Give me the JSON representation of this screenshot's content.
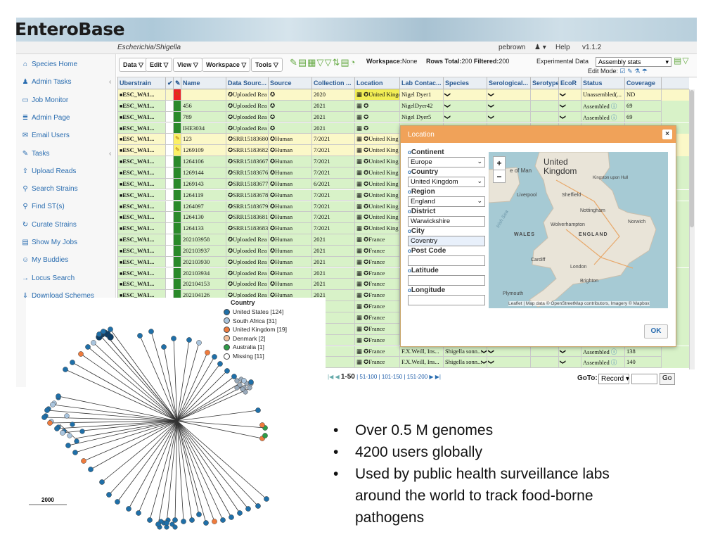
{
  "app": {
    "logo": "EnteroBase",
    "organism": "Escherichia/Shigella",
    "user": "pebrown",
    "help": "Help",
    "version": "v1.1.2"
  },
  "sidebar": [
    {
      "label": "Species Home",
      "icon": "home-icon",
      "glyph": "⌂"
    },
    {
      "label": "Admin Tasks",
      "icon": "person-icon",
      "glyph": "♟",
      "chevron": "‹"
    },
    {
      "label": "Job Monitor",
      "icon": "monitor-icon",
      "glyph": "▭"
    },
    {
      "label": "Admin Page",
      "icon": "page-icon",
      "glyph": "≣"
    },
    {
      "label": "Email Users",
      "icon": "envelope-icon",
      "glyph": "✉"
    },
    {
      "label": "Tasks",
      "icon": "wrench-icon",
      "glyph": "✎",
      "chevron": "‹"
    },
    {
      "label": "Upload Reads",
      "icon": "upload-icon",
      "glyph": "⇪"
    },
    {
      "label": "Search Strains",
      "icon": "search-strains-icon",
      "glyph": "⚲"
    },
    {
      "label": "Find ST(s)",
      "icon": "magnifier-icon",
      "glyph": "⚲"
    },
    {
      "label": "Curate Strains",
      "icon": "refresh-icon",
      "glyph": "↻"
    },
    {
      "label": "Show My Jobs",
      "icon": "list-icon",
      "glyph": "▤"
    },
    {
      "label": "My Buddies",
      "icon": "people-icon",
      "glyph": "☺"
    },
    {
      "label": "Locus Search",
      "icon": "arrow-icon",
      "glyph": "→"
    },
    {
      "label": "Download Schemes",
      "icon": "download-icon",
      "glyph": "⇓"
    }
  ],
  "toolbar": {
    "menus": [
      "Data",
      "Edit",
      "View",
      "Workspace",
      "Tools"
    ],
    "workspace_label": "Workspace:",
    "workspace_value": "None",
    "rows_total_label": "Rows Total:",
    "rows_total": "200",
    "filtered_label": "Filtered:",
    "filtered": "200",
    "experimental_label": "Experimental Data",
    "experimental_value": "Assembly stats",
    "edit_mode_label": "Edit Mode:"
  },
  "columns": [
    "Uberstrain",
    "✔",
    "✎",
    "Name",
    "Data Sourc...",
    "Source",
    "Collection ...",
    "Location",
    "Lab Contac...",
    "Species",
    "Serological...",
    "Serotype",
    "EcoR",
    "Status",
    "Coverage"
  ],
  "rows": [
    {
      "uber": "ESC_WA1...",
      "mark": "red",
      "name": "",
      "ds": "Uploaded Rea",
      "src": "",
      "date": "2020",
      "loc": "United Kingdo",
      "lab": "Nigel Dyer1",
      "sp": "",
      "status": "Unassembled(...",
      "cov": "ND",
      "bg": "yellow"
    },
    {
      "uber": "ESC_WA1...",
      "mark": "green",
      "name": "456",
      "ds": "Uploaded Rea",
      "src": "",
      "date": "2021",
      "loc": "",
      "lab": "NigelDyer42",
      "sp": "",
      "status": "Assembled",
      "cov": "69",
      "bg": "green"
    },
    {
      "uber": "ESC_WA1...",
      "mark": "green",
      "name": "789",
      "ds": "Uploaded Rea",
      "src": "",
      "date": "2021",
      "loc": "",
      "lab": "Nigel Dyer5",
      "sp": "",
      "status": "Assembled",
      "cov": "69",
      "bg": "green"
    },
    {
      "uber": "ESC_WA1...",
      "mark": "green",
      "name": "IHE3034",
      "ds": "Uploaded Rea",
      "src": "",
      "date": "2021",
      "loc": "",
      "lab": "",
      "sp": "",
      "status": "",
      "cov": "",
      "bg": "green"
    },
    {
      "uber": "ESC_WA1...",
      "mark": "yellow",
      "name": "123",
      "ds": "SRR15183680",
      "src": "Human",
      "date": "7/2021",
      "loc": "United King",
      "lab": "",
      "sp": "",
      "status": "",
      "cov": "",
      "bg": "yellow"
    },
    {
      "uber": "ESC_WA1...",
      "mark": "yellow",
      "name": "1269109",
      "ds": "SRR15183682",
      "src": "Human",
      "date": "7/2021",
      "loc": "United King",
      "lab": "",
      "sp": "",
      "status": "",
      "cov": "",
      "bg": "yellow"
    },
    {
      "uber": "ESC_WA1...",
      "mark": "green",
      "name": "1264106",
      "ds": "SRR15183667",
      "src": "Human",
      "date": "7/2021",
      "loc": "United King",
      "lab": "",
      "sp": "",
      "status": "",
      "cov": "",
      "bg": "green"
    },
    {
      "uber": "ESC_WA1...",
      "mark": "green",
      "name": "1269144",
      "ds": "SRR15183676",
      "src": "Human",
      "date": "7/2021",
      "loc": "United King",
      "lab": "",
      "sp": "",
      "status": "",
      "cov": "",
      "bg": "green"
    },
    {
      "uber": "ESC_WA1...",
      "mark": "green",
      "name": "1269143",
      "ds": "SRR15183677",
      "src": "Human",
      "date": "6/2021",
      "loc": "United King",
      "lab": "",
      "sp": "",
      "status": "",
      "cov": "",
      "bg": "green"
    },
    {
      "uber": "ESC_WA1...",
      "mark": "green",
      "name": "1264119",
      "ds": "SRR15183678",
      "src": "Human",
      "date": "7/2021",
      "loc": "United King",
      "lab": "",
      "sp": "",
      "status": "",
      "cov": "",
      "bg": "green"
    },
    {
      "uber": "ESC_WA1...",
      "mark": "green",
      "name": "1264097",
      "ds": "SRR15183679",
      "src": "Human",
      "date": "7/2021",
      "loc": "United King",
      "lab": "",
      "sp": "",
      "status": "",
      "cov": "",
      "bg": "green"
    },
    {
      "uber": "ESC_WA1...",
      "mark": "green",
      "name": "1264130",
      "ds": "SRR15183681",
      "src": "Human",
      "date": "7/2021",
      "loc": "United King",
      "lab": "",
      "sp": "",
      "status": "",
      "cov": "",
      "bg": "green"
    },
    {
      "uber": "ESC_WA1...",
      "mark": "green",
      "name": "1264133",
      "ds": "SRR15183683",
      "src": "Human",
      "date": "7/2021",
      "loc": "United King",
      "lab": "",
      "sp": "",
      "status": "",
      "cov": "",
      "bg": "green"
    },
    {
      "uber": "ESC_WA1...",
      "mark": "green",
      "name": "202103958",
      "ds": "Uploaded Rea",
      "src": "Human",
      "date": "2021",
      "loc": "France",
      "lab": "",
      "sp": "",
      "status": "",
      "cov": "",
      "bg": "green"
    },
    {
      "uber": "ESC_WA1...",
      "mark": "green",
      "name": "202103937",
      "ds": "Uploaded Rea",
      "src": "Human",
      "date": "2021",
      "loc": "France",
      "lab": "",
      "sp": "",
      "status": "",
      "cov": "",
      "bg": "green"
    },
    {
      "uber": "ESC_WA1...",
      "mark": "green",
      "name": "202103930",
      "ds": "Uploaded Rea",
      "src": "Human",
      "date": "2021",
      "loc": "France",
      "lab": "",
      "sp": "",
      "status": "",
      "cov": "",
      "bg": "green"
    },
    {
      "uber": "ESC_WA1...",
      "mark": "green",
      "name": "202103934",
      "ds": "Uploaded Rea",
      "src": "Human",
      "date": "2021",
      "loc": "France",
      "lab": "",
      "sp": "",
      "status": "",
      "cov": "",
      "bg": "green"
    },
    {
      "uber": "ESC_WA1...",
      "mark": "green",
      "name": "202104153",
      "ds": "Uploaded Rea",
      "src": "Human",
      "date": "2021",
      "loc": "France",
      "lab": "",
      "sp": "",
      "status": "",
      "cov": "",
      "bg": "green"
    },
    {
      "uber": "ESC_WA1...",
      "mark": "green",
      "name": "202104126",
      "ds": "Uploaded Rea",
      "src": "Human",
      "date": "2021",
      "loc": "France",
      "lab": "",
      "sp": "",
      "status": "",
      "cov": "",
      "bg": "green"
    },
    {
      "uber": "",
      "mark": "",
      "name": "",
      "ds": "",
      "src": "",
      "date": "21",
      "loc": "France",
      "lab": "",
      "sp": "",
      "status": "",
      "cov": "",
      "bg": "green"
    },
    {
      "uber": "",
      "mark": "",
      "name": "",
      "ds": "",
      "src": "",
      "date": "21",
      "loc": "France",
      "lab": "",
      "sp": "",
      "status": "",
      "cov": "",
      "bg": "green"
    },
    {
      "uber": "",
      "mark": "",
      "name": "",
      "ds": "",
      "src": "",
      "date": "21",
      "loc": "France",
      "lab": "",
      "sp": "",
      "status": "",
      "cov": "",
      "bg": "green"
    },
    {
      "uber": "",
      "mark": "",
      "name": "",
      "ds": "",
      "src": "",
      "date": "21",
      "loc": "France",
      "lab": "",
      "sp": "",
      "status": "",
      "cov": "",
      "bg": "green"
    },
    {
      "uber": "",
      "mark": "",
      "name": "",
      "ds": "",
      "src": "",
      "date": "21",
      "loc": "France",
      "lab": "F.X.Weill, Ins...",
      "sp": "Shigella sonn...",
      "status": "Assembled",
      "cov": "138",
      "bg": "green"
    },
    {
      "uber": "",
      "mark": "",
      "name": "",
      "ds": "",
      "src": "",
      "date": "21",
      "loc": "France",
      "lab": "F.X.Weill, Ins...",
      "sp": "Shigella sonn...",
      "status": "Assembled",
      "cov": "140",
      "bg": "green"
    }
  ],
  "pager": {
    "current": "1-50",
    "pages": [
      "51-100",
      "101-150",
      "151-200"
    ],
    "goto_label": "GoTo:",
    "goto_select": "Record",
    "go_button": "Go"
  },
  "location_dialog": {
    "title": "Location",
    "close": "×",
    "fields": [
      {
        "label": "Continent",
        "value": "Europe",
        "type": "select"
      },
      {
        "label": "Country",
        "value": "United Kingdom",
        "type": "select"
      },
      {
        "label": "Region",
        "value": "England",
        "type": "select"
      },
      {
        "label": "District",
        "value": "Warwickshire",
        "type": "text"
      },
      {
        "label": "City",
        "value": "Coventry",
        "type": "text"
      },
      {
        "label": "Post Code",
        "value": "",
        "type": "text"
      },
      {
        "label": "Latitude",
        "value": "",
        "type": "text"
      },
      {
        "label": "Longitude",
        "value": "",
        "type": "text"
      }
    ],
    "map": {
      "zoom_in": "+",
      "zoom_out": "−",
      "labels": [
        "United Kingdom",
        "e of Man",
        "Kingston upon Hull",
        "Liverpool",
        "Sheffield",
        "Nottingham",
        "Wolverhampton",
        "Norwich",
        "WALES",
        "ENGLAND",
        "Cardiff",
        "London",
        "Brighton",
        "Plymouth",
        "Irish Sea"
      ],
      "attribution": "Leaflet | Map data © OpenStreetMap contributors, Imagery © Mapbox"
    },
    "ok": "OK"
  },
  "tree": {
    "legend_title": "Country",
    "legend": [
      {
        "label": "United States [124]",
        "color": "#1f6fa8"
      },
      {
        "label": "South Africa [31]",
        "color": "#a9c4dd"
      },
      {
        "label": "United Kingdom [19]",
        "color": "#ef7b3d"
      },
      {
        "label": "Denmark [2]",
        "color": "#f5c09a"
      },
      {
        "label": "Australia [1]",
        "color": "#2e9c48"
      },
      {
        "label": "Missing [11]",
        "color": "#ffffff"
      }
    ],
    "scale_label": "2000"
  },
  "bullets": [
    "Over 0.5 M genomes",
    " 4200 users globally",
    "Used by public health surveillance labs",
    "around the world to track food-borne",
    "pathogens"
  ]
}
